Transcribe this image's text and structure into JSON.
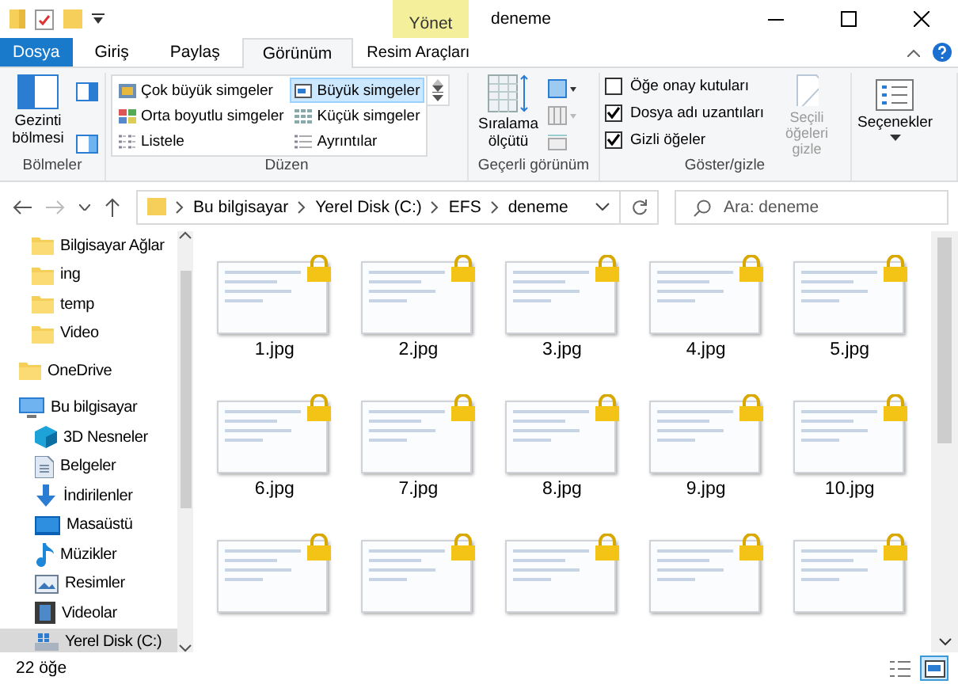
{
  "title_bar": {
    "contextual_tab": "Yönet",
    "title": "deneme"
  },
  "ribbon_tabs": [
    {
      "label": "Dosya",
      "kind": "file",
      "selected": false
    },
    {
      "label": "Giriş",
      "kind": "normal",
      "selected": false
    },
    {
      "label": "Paylaş",
      "kind": "normal",
      "selected": false
    },
    {
      "label": "Görünüm",
      "kind": "normal",
      "selected": true
    },
    {
      "label": "Resim Araçları",
      "kind": "contextual",
      "selected": false
    }
  ],
  "ribbon": {
    "panes": {
      "label": "Bölmeler",
      "nav_pane_button": "Gezinti bölmesi"
    },
    "layout": {
      "label": "Düzen",
      "options": [
        {
          "label": "Çok büyük simgeler",
          "selected": false
        },
        {
          "label": "Büyük simgeler",
          "selected": true
        },
        {
          "label": "Orta boyutlu simgeler",
          "selected": false
        },
        {
          "label": "Küçük simgeler",
          "selected": false
        },
        {
          "label": "Listele",
          "selected": false
        },
        {
          "label": "Ayrıntılar",
          "selected": false
        }
      ]
    },
    "current_view": {
      "label": "Geçerli görünüm",
      "sort_button": "Sıralama ölçütü"
    },
    "show_hide": {
      "label": "Göster/gizle",
      "checkboxes": [
        {
          "label": "Öğe onay kutuları",
          "checked": false
        },
        {
          "label": "Dosya adı uzantıları",
          "checked": true
        },
        {
          "label": "Gizli öğeler",
          "checked": true
        }
      ],
      "hide_button": {
        "label": "Seçili öğeleri gizle",
        "disabled": true
      }
    },
    "options_button": "Seçenekler"
  },
  "address_bar": {
    "path": [
      "Bu bilgisayar",
      "Yerel Disk (C:)",
      "EFS",
      "deneme"
    ],
    "search_placeholder": "Ara: deneme"
  },
  "nav_pane": {
    "partial_group": [
      {
        "label": "Bilgisayar Ağlar",
        "kind": "folder"
      },
      {
        "label": "ing",
        "kind": "folder"
      },
      {
        "label": "temp",
        "kind": "folder"
      },
      {
        "label": "Video",
        "kind": "folder"
      }
    ],
    "items": [
      {
        "label": "OneDrive",
        "kind": "folder",
        "selected": false
      },
      {
        "label": "Bu bilgisayar",
        "kind": "pc",
        "selected": false,
        "children": [
          {
            "label": "3D Nesneler",
            "kind": "cube",
            "selected": false
          },
          {
            "label": "Belgeler",
            "kind": "document",
            "selected": false
          },
          {
            "label": "İndirilenler",
            "kind": "download",
            "selected": false
          },
          {
            "label": "Masaüstü",
            "kind": "desktop",
            "selected": false
          },
          {
            "label": "Müzikler",
            "kind": "music",
            "selected": false
          },
          {
            "label": "Resimler",
            "kind": "pictures",
            "selected": false
          },
          {
            "label": "Videolar",
            "kind": "video",
            "selected": false
          },
          {
            "label": "Yerel Disk (C:)",
            "kind": "drive",
            "selected": true
          }
        ]
      }
    ]
  },
  "files": [
    {
      "name": "1.jpg",
      "locked": true
    },
    {
      "name": "2.jpg",
      "locked": true
    },
    {
      "name": "3.jpg",
      "locked": true
    },
    {
      "name": "4.jpg",
      "locked": true
    },
    {
      "name": "5.jpg",
      "locked": true
    },
    {
      "name": "6.jpg",
      "locked": true
    },
    {
      "name": "7.jpg",
      "locked": true
    },
    {
      "name": "8.jpg",
      "locked": true
    },
    {
      "name": "9.jpg",
      "locked": true
    },
    {
      "name": "10.jpg",
      "locked": true
    },
    {
      "locked": true
    },
    {
      "locked": true
    },
    {
      "locked": true
    },
    {
      "locked": true
    },
    {
      "locked": true
    }
  ],
  "status_bar": {
    "count": "22 öğe",
    "view_buttons": [
      {
        "kind": "details",
        "selected": false
      },
      {
        "kind": "large_icons",
        "selected": true
      }
    ]
  }
}
